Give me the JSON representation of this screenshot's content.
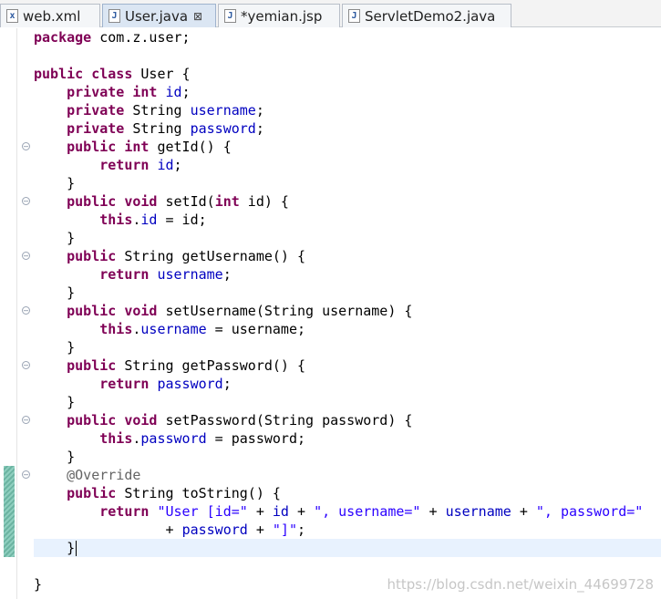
{
  "tabs": [
    {
      "label": "web.xml",
      "icon": "xml-file-icon",
      "icon_glyph": "x",
      "active": false
    },
    {
      "label": "User.java",
      "icon": "java-file-icon",
      "icon_glyph": "J",
      "active": true,
      "close_glyph": "⊠"
    },
    {
      "label": "*yemian.jsp",
      "icon": "jsp-file-icon",
      "icon_glyph": "J",
      "active": false
    },
    {
      "label": "ServletDemo2.java",
      "icon": "java-file-icon",
      "icon_glyph": "J",
      "active": false
    }
  ],
  "code": {
    "lines": [
      [
        [
          "kw",
          "package"
        ],
        [
          "t",
          " com.z.user;"
        ]
      ],
      [],
      [
        [
          "kw",
          "public class"
        ],
        [
          "t",
          " User {"
        ]
      ],
      [
        [
          "t",
          "    "
        ],
        [
          "kw",
          "private int"
        ],
        [
          "t",
          " "
        ],
        [
          "fld",
          "id"
        ],
        [
          "t",
          ";"
        ]
      ],
      [
        [
          "t",
          "    "
        ],
        [
          "kw",
          "private"
        ],
        [
          "t",
          " String "
        ],
        [
          "fld",
          "username"
        ],
        [
          "t",
          ";"
        ]
      ],
      [
        [
          "t",
          "    "
        ],
        [
          "kw",
          "private"
        ],
        [
          "t",
          " String "
        ],
        [
          "fld",
          "password"
        ],
        [
          "t",
          ";"
        ]
      ],
      [
        [
          "t",
          "    "
        ],
        [
          "kw",
          "public int"
        ],
        [
          "t",
          " getId() {"
        ]
      ],
      [
        [
          "t",
          "        "
        ],
        [
          "kw",
          "return"
        ],
        [
          "t",
          " "
        ],
        [
          "fld",
          "id"
        ],
        [
          "t",
          ";"
        ]
      ],
      [
        [
          "t",
          "    }"
        ]
      ],
      [
        [
          "t",
          "    "
        ],
        [
          "kw",
          "public void"
        ],
        [
          "t",
          " setId("
        ],
        [
          "kw",
          "int"
        ],
        [
          "t",
          " id) {"
        ]
      ],
      [
        [
          "t",
          "        "
        ],
        [
          "kw",
          "this"
        ],
        [
          "t",
          "."
        ],
        [
          "fld",
          "id"
        ],
        [
          "t",
          " = id;"
        ]
      ],
      [
        [
          "t",
          "    }"
        ]
      ],
      [
        [
          "t",
          "    "
        ],
        [
          "kw",
          "public"
        ],
        [
          "t",
          " String getUsername() {"
        ]
      ],
      [
        [
          "t",
          "        "
        ],
        [
          "kw",
          "return"
        ],
        [
          "t",
          " "
        ],
        [
          "fld",
          "username"
        ],
        [
          "t",
          ";"
        ]
      ],
      [
        [
          "t",
          "    }"
        ]
      ],
      [
        [
          "t",
          "    "
        ],
        [
          "kw",
          "public void"
        ],
        [
          "t",
          " setUsername(String username) {"
        ]
      ],
      [
        [
          "t",
          "        "
        ],
        [
          "kw",
          "this"
        ],
        [
          "t",
          "."
        ],
        [
          "fld",
          "username"
        ],
        [
          "t",
          " = username;"
        ]
      ],
      [
        [
          "t",
          "    }"
        ]
      ],
      [
        [
          "t",
          "    "
        ],
        [
          "kw",
          "public"
        ],
        [
          "t",
          " String getPassword() {"
        ]
      ],
      [
        [
          "t",
          "        "
        ],
        [
          "kw",
          "return"
        ],
        [
          "t",
          " "
        ],
        [
          "fld",
          "password"
        ],
        [
          "t",
          ";"
        ]
      ],
      [
        [
          "t",
          "    }"
        ]
      ],
      [
        [
          "t",
          "    "
        ],
        [
          "kw",
          "public void"
        ],
        [
          "t",
          " setPassword(String password) {"
        ]
      ],
      [
        [
          "t",
          "        "
        ],
        [
          "kw",
          "this"
        ],
        [
          "t",
          "."
        ],
        [
          "fld",
          "password"
        ],
        [
          "t",
          " = password;"
        ]
      ],
      [
        [
          "t",
          "    }"
        ]
      ],
      [
        [
          "t",
          "    "
        ],
        [
          "ann",
          "@Override"
        ]
      ],
      [
        [
          "t",
          "    "
        ],
        [
          "kw",
          "public"
        ],
        [
          "t",
          " String toString() {"
        ]
      ],
      [
        [
          "t",
          "        "
        ],
        [
          "kw",
          "return"
        ],
        [
          "t",
          " "
        ],
        [
          "str",
          "\"User [id=\""
        ],
        [
          "t",
          " + "
        ],
        [
          "fld",
          "id"
        ],
        [
          "t",
          " + "
        ],
        [
          "str",
          "\", username=\""
        ],
        [
          "t",
          " + "
        ],
        [
          "fld",
          "username"
        ],
        [
          "t",
          " + "
        ],
        [
          "str",
          "\", password=\""
        ]
      ],
      [
        [
          "t",
          "                + "
        ],
        [
          "fld",
          "password"
        ],
        [
          "t",
          " + "
        ],
        [
          "str",
          "\"]\""
        ],
        [
          "t",
          ";"
        ]
      ],
      [
        [
          "t",
          "    }"
        ]
      ],
      [],
      [
        [
          "t",
          "}"
        ]
      ]
    ],
    "fold_lines": [
      6,
      9,
      12,
      15,
      18,
      21,
      24
    ],
    "current_line": 28
  },
  "watermark": "https://blog.csdn.net/weixin_44699728"
}
